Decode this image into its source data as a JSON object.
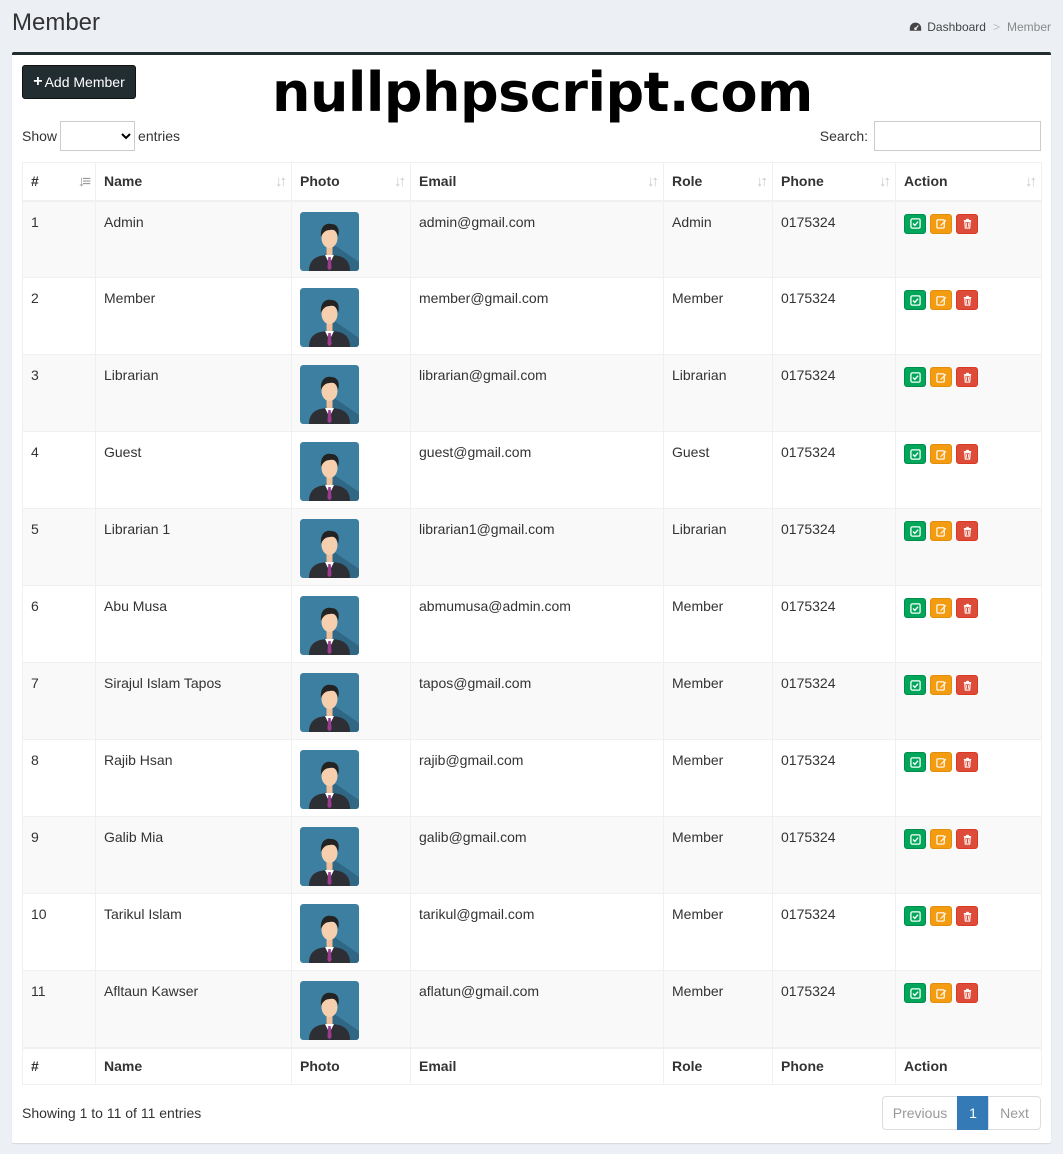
{
  "header": {
    "title": "Member"
  },
  "breadcrumb": {
    "home": "Dashboard",
    "separator": ">",
    "current": "Member"
  },
  "toolbar": {
    "add_label": "Add Member"
  },
  "watermark": "nullphpscript.com",
  "length_control": {
    "show_label": "Show",
    "entries_label": "entries",
    "selected": ""
  },
  "search": {
    "label": "Search:",
    "value": ""
  },
  "table": {
    "columns": [
      "#",
      "Name",
      "Photo",
      "Email",
      "Role",
      "Phone",
      "Action"
    ],
    "rows": [
      {
        "no": "1",
        "name": "Admin",
        "email": "admin@gmail.com",
        "role": "Admin",
        "phone": "0175324"
      },
      {
        "no": "2",
        "name": "Member",
        "email": "member@gmail.com",
        "role": "Member",
        "phone": "0175324"
      },
      {
        "no": "3",
        "name": "Librarian",
        "email": "librarian@gmail.com",
        "role": "Librarian",
        "phone": "0175324"
      },
      {
        "no": "4",
        "name": "Guest",
        "email": "guest@gmail.com",
        "role": "Guest",
        "phone": "0175324"
      },
      {
        "no": "5",
        "name": "Librarian 1",
        "email": "librarian1@gmail.com",
        "role": "Librarian",
        "phone": "0175324"
      },
      {
        "no": "6",
        "name": "Abu Musa",
        "email": "abmumusa@admin.com",
        "role": "Member",
        "phone": "0175324"
      },
      {
        "no": "7",
        "name": "Sirajul Islam Tapos",
        "email": "tapos@gmail.com",
        "role": "Member",
        "phone": "0175324"
      },
      {
        "no": "8",
        "name": "Rajib Hsan",
        "email": "rajib@gmail.com",
        "role": "Member",
        "phone": "0175324"
      },
      {
        "no": "9",
        "name": "Galib Mia",
        "email": "galib@gmail.com",
        "role": "Member",
        "phone": "0175324"
      },
      {
        "no": "10",
        "name": "Tarikul Islam",
        "email": "tarikul@gmail.com",
        "role": "Member",
        "phone": "0175324"
      },
      {
        "no": "11",
        "name": "Afltaun Kawser",
        "email": "aflatun@gmail.com",
        "role": "Member",
        "phone": "0175324"
      }
    ]
  },
  "footer": {
    "info": "Showing 1 to 11 of 11 entries",
    "pagination": {
      "previous": "Previous",
      "current": "1",
      "next": "Next"
    }
  },
  "icons": {
    "add": "plus-icon",
    "breadcrumb": "dashboard-icon",
    "view": "check-square-icon",
    "edit": "edit-icon",
    "delete": "trash-icon",
    "sort": "sort-icon",
    "photo": "avatar-placeholder"
  },
  "colors": {
    "header_bar": "#222d32",
    "view": "#00a65a",
    "edit": "#f39c12",
    "delete": "#dd4b39",
    "page_active": "#337ab7",
    "background": "#ecf0f5"
  }
}
